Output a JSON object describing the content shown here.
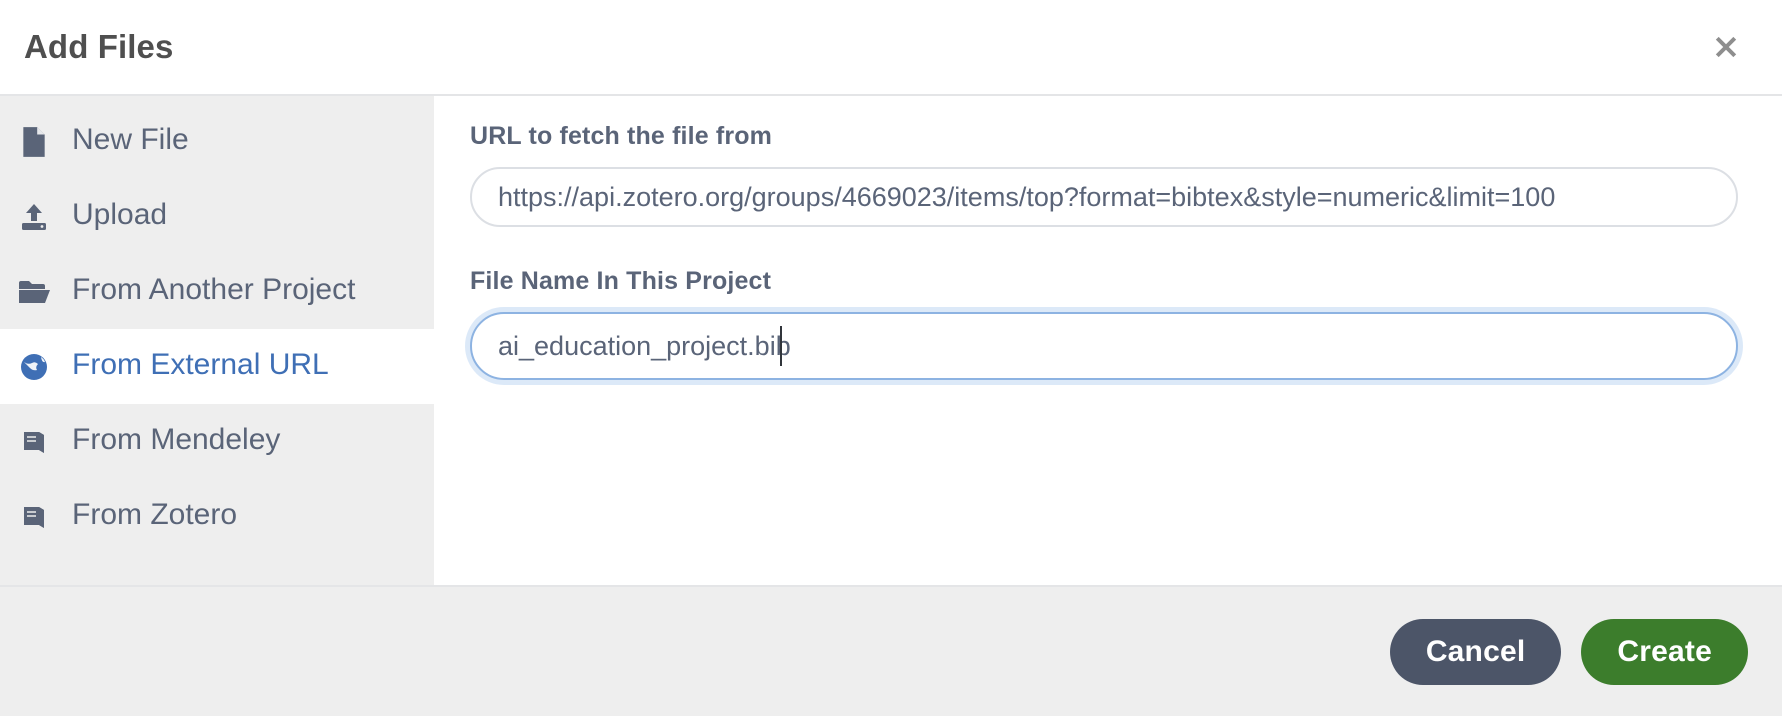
{
  "dialog": {
    "title": "Add Files",
    "close_icon": "close-icon"
  },
  "sidebar": {
    "items": [
      {
        "label": "New File",
        "icon": "file-icon",
        "active": false
      },
      {
        "label": "Upload",
        "icon": "upload-icon",
        "active": false
      },
      {
        "label": "From Another Project",
        "icon": "folder-open-icon",
        "active": false
      },
      {
        "label": "From External URL",
        "icon": "globe-icon",
        "active": true
      },
      {
        "label": "From Mendeley",
        "icon": "book-icon",
        "active": false
      },
      {
        "label": "From Zotero",
        "icon": "book-icon",
        "active": false
      }
    ]
  },
  "form": {
    "url_label": "URL to fetch the file from",
    "url_value": "https://api.zotero.org/groups/4669023/items/top?format=bibtex&style=numeric&limit=100",
    "url_placeholder": "https://",
    "filename_label": "File Name In This Project",
    "filename_value": "ai_education_project.bib",
    "filename_placeholder": "File name"
  },
  "footer": {
    "cancel_label": "Cancel",
    "create_label": "Create"
  },
  "colors": {
    "accent_blue": "#3f6fb5",
    "text_slate": "#5a6478",
    "cancel_bg": "#4c5568",
    "create_bg": "#3c7d2c",
    "sidebar_bg": "#eeeeee"
  }
}
